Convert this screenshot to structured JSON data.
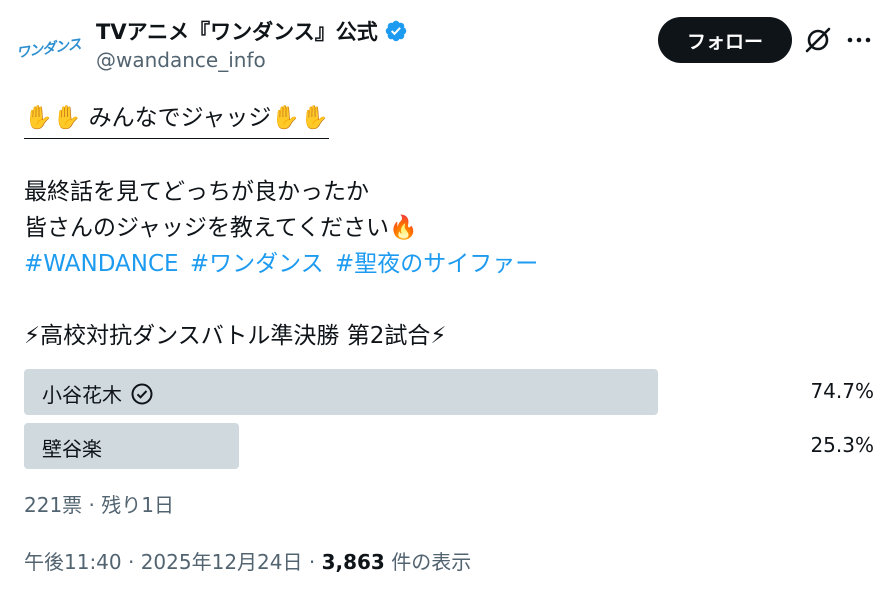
{
  "author": {
    "avatar_text": "ワンダンス",
    "display_name": "TVアニメ『ワンダンス』公式",
    "handle": "@wandance_info",
    "verified_color": "#1d9bf0"
  },
  "actions": {
    "follow_label": "フォロー",
    "grok_icon": "grok-icon",
    "more_icon": "more-icon"
  },
  "tweet": {
    "line1": "✋✋ みんなでジャッジ✋✋",
    "line2": "最終話を見てどっちが良かったか",
    "line3": "皆さんのジャッジを教えてください🔥",
    "hashtags": [
      "#WANDANCE",
      "#ワンダンス",
      "#聖夜のサイファー"
    ],
    "line5": "⚡高校対抗ダンスバトル準決勝 第2試合⚡"
  },
  "poll": {
    "options": [
      {
        "label": "小谷花木",
        "percent_text": "74.7%",
        "percent": 74.7,
        "winner": true
      },
      {
        "label": "壁谷楽",
        "percent_text": "25.3%",
        "percent": 25.3,
        "winner": false
      }
    ],
    "meta": "221票 · 残り1日"
  },
  "footer": {
    "time": "午後11:40 · 2025年12月24日 · ",
    "views_count": "3,863",
    "views_label": " 件の表示"
  }
}
